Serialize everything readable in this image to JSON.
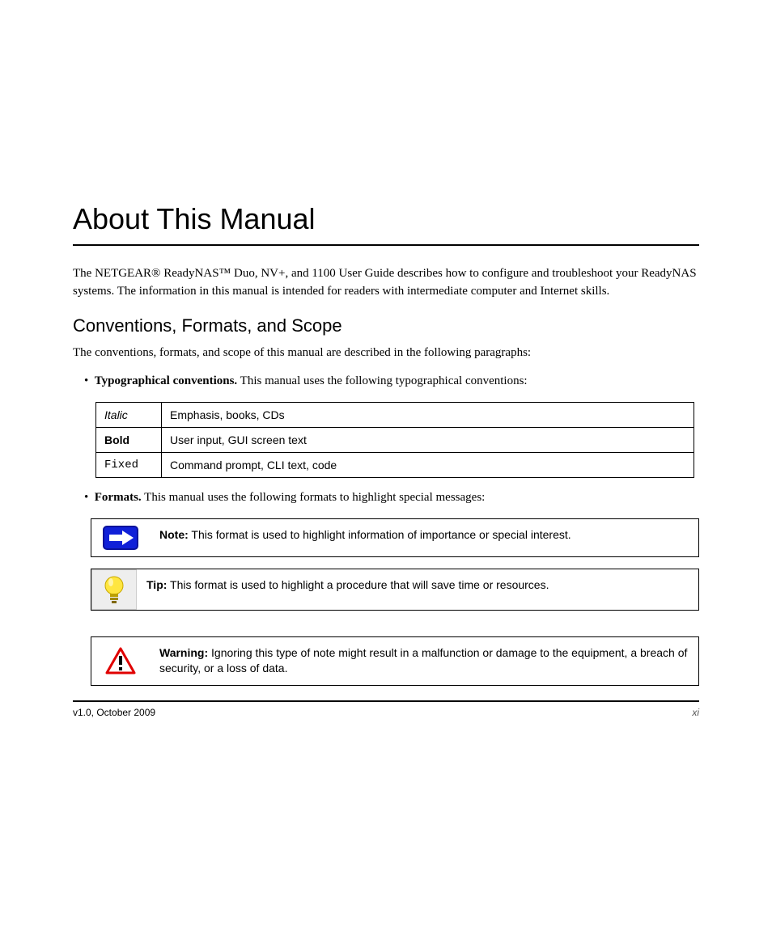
{
  "title": "About This Manual",
  "intro": "The NETGEAR® ReadyNAS™ Duo, NV+, and 1100 User Guide describes how to configure and troubleshoot your ReadyNAS systems. The information in this manual is intended for readers with intermediate computer and Internet skills.",
  "sections": {
    "conventions": {
      "heading": "Conventions, Formats, and Scope",
      "lead": "The conventions, formats, and scope of this manual are described in the following paragraphs:",
      "typo_label_full": "Typographical conventions.",
      "typo_label_strong": "Typographical conventions.",
      "typo_rest": " This manual uses the following typographical conventions:",
      "table": [
        {
          "style": "Italic",
          "desc": "Emphasis, books, CDs"
        },
        {
          "style": "Bold",
          "desc": "User input, GUI screen text"
        },
        {
          "style": "Fixed",
          "desc": "Command prompt, CLI text, code"
        }
      ],
      "formats_label": "Formats.",
      "formats_rest": " This manual uses the following formats to highlight special messages:"
    }
  },
  "callouts": {
    "note": {
      "label": "Note:",
      "text": " This format is used to highlight information of importance or special interest."
    },
    "tip": {
      "label": "Tip:",
      "text": " This format is used to highlight a procedure that will save time or resources."
    },
    "warning": {
      "label": "Warning:",
      "text": " Ignoring this type of note might result in a malfunction or damage to the equipment, a breach of security, or a loss of data."
    }
  },
  "footer": {
    "left": "v1.0, October 2009",
    "right": "xi"
  }
}
